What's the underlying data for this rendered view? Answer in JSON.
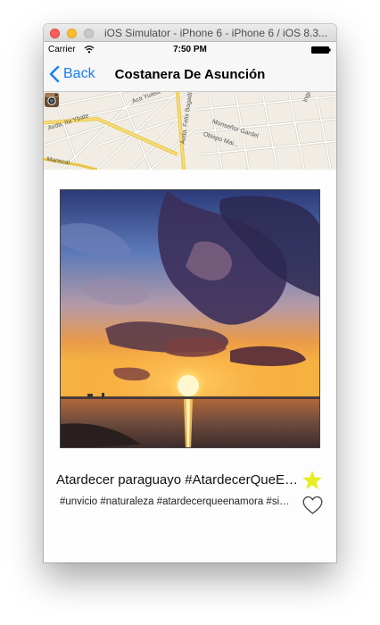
{
  "window": {
    "title": "iOS Simulator - iPhone 6 - iPhone 6 / iOS 8.3..."
  },
  "status_bar": {
    "carrier": "Carrier",
    "time": "7:50 PM",
    "icons": [
      "wifi-icon",
      "battery-icon"
    ]
  },
  "nav_bar": {
    "back_label": "Back",
    "title": "Costanera De Asunción"
  },
  "map": {
    "street_labels": [
      "Avda. Ita Ybate",
      "Aca Yuasa",
      "Avda. Felix Bogado",
      "Monseñor Gardel",
      "Obispo Mai...",
      "Ingat...",
      "Mariscal"
    ],
    "pin_icon": "instagram-icon"
  },
  "post": {
    "title": "Atardecer paraguayo #AtardecerQueE…",
    "tags": "#unvicio #naturaleza #atardecerqueenamora #si…",
    "actions": [
      "star-icon",
      "heart-icon"
    ]
  },
  "colors": {
    "ios_blue": "#157efb",
    "star_yellow": "#e6ee22"
  }
}
